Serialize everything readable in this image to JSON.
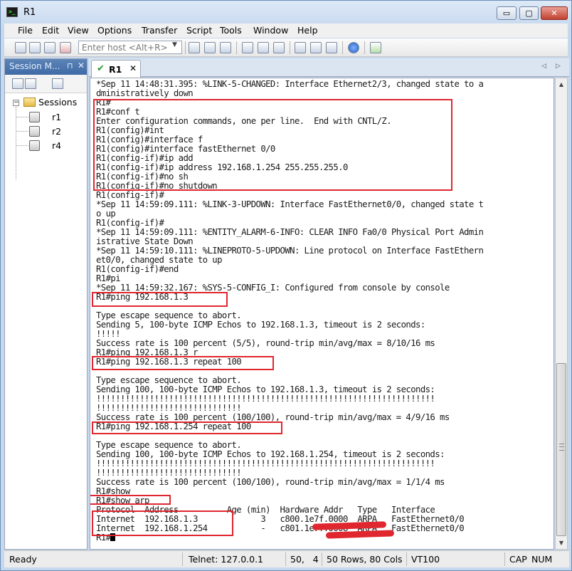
{
  "window": {
    "title": "R1",
    "buttons": {
      "minimize": "▭",
      "maximize": "▢",
      "close": "✕"
    }
  },
  "menu": [
    "File",
    "Edit",
    "View",
    "Options",
    "Transfer",
    "Script",
    "Tools",
    "Window",
    "Help"
  ],
  "toolbar": {
    "host_placeholder": "Enter host <Alt+R>"
  },
  "session_manager": {
    "title": "Session M...",
    "pin": "⊓",
    "close": "✕",
    "root": "Sessions",
    "items": [
      "r1",
      "r2",
      "r4"
    ]
  },
  "tab": {
    "label": "R1",
    "close": "✕"
  },
  "terminal": {
    "lines": [
      "*Sep 11 14:48:31.395: %LINK-5-CHANGED: Interface Ethernet2/3, changed state to a",
      "dministratively down",
      "R1#",
      "R1#conf t",
      "Enter configuration commands, one per line.  End with CNTL/Z.",
      "R1(config)#int",
      "R1(config)#interface f",
      "R1(config)#interface fastEthernet 0/0",
      "R1(config-if)#ip add",
      "R1(config-if)#ip address 192.168.1.254 255.255.255.0",
      "R1(config-if)#no sh",
      "R1(config-if)#no shutdown",
      "R1(config-if)#",
      "*Sep 11 14:59:09.111: %LINK-3-UPDOWN: Interface FastEthernet0/0, changed state t",
      "o up",
      "R1(config-if)#",
      "*Sep 11 14:59:09.111: %ENTITY_ALARM-6-INFO: CLEAR INFO Fa0/0 Physical Port Admin",
      "istrative State Down",
      "*Sep 11 14:59:10.111: %LINEPROTO-5-UPDOWN: Line protocol on Interface FastEthern",
      "et0/0, changed state to up",
      "R1(config-if)#end",
      "R1#pi",
      "*Sep 11 14:59:32.167: %SYS-5-CONFIG_I: Configured from console by console",
      "R1#ping 192.168.1.3",
      "",
      "Type escape sequence to abort.",
      "Sending 5, 100-byte ICMP Echos to 192.168.1.3, timeout is 2 seconds:",
      "!!!!!",
      "Success rate is 100 percent (5/5), round-trip min/avg/max = 8/10/16 ms",
      "R1#ping 192.168.1.3 r",
      "R1#ping 192.168.1.3 repeat 100",
      "",
      "Type escape sequence to abort.",
      "Sending 100, 100-byte ICMP Echos to 192.168.1.3, timeout is 2 seconds:",
      "!!!!!!!!!!!!!!!!!!!!!!!!!!!!!!!!!!!!!!!!!!!!!!!!!!!!!!!!!!!!!!!!!!!!!!",
      "!!!!!!!!!!!!!!!!!!!!!!!!!!!!!!",
      "Success rate is 100 percent (100/100), round-trip min/avg/max = 4/9/16 ms",
      "R1#ping 192.168.1.254 repeat 100",
      "",
      "Type escape sequence to abort.",
      "Sending 100, 100-byte ICMP Echos to 192.168.1.254, timeout is 2 seconds:",
      "!!!!!!!!!!!!!!!!!!!!!!!!!!!!!!!!!!!!!!!!!!!!!!!!!!!!!!!!!!!!!!!!!!!!!!",
      "!!!!!!!!!!!!!!!!!!!!!!!!!!!!!!",
      "Success rate is 100 percent (100/100), round-trip min/avg/max = 1/1/4 ms",
      "R1#show",
      "R1#show arp",
      "Protocol  Address          Age (min)  Hardware Addr   Type   Interface",
      "Internet  192.168.1.3             3   c800.1e7f.0000  ARPA   FastEthernet0/0",
      "Internet  192.168.1.254           -   c801.1e7f.0008  ARPA   FastEthernet0/0",
      "R1#"
    ]
  },
  "statusbar": {
    "ready": "Ready",
    "connection": "Telnet: 127.0.0.1",
    "position": "50,   4",
    "size": "50 Rows, 80 Cols",
    "emulation": "VT100",
    "caps": "CAP",
    "num": "NUM"
  }
}
